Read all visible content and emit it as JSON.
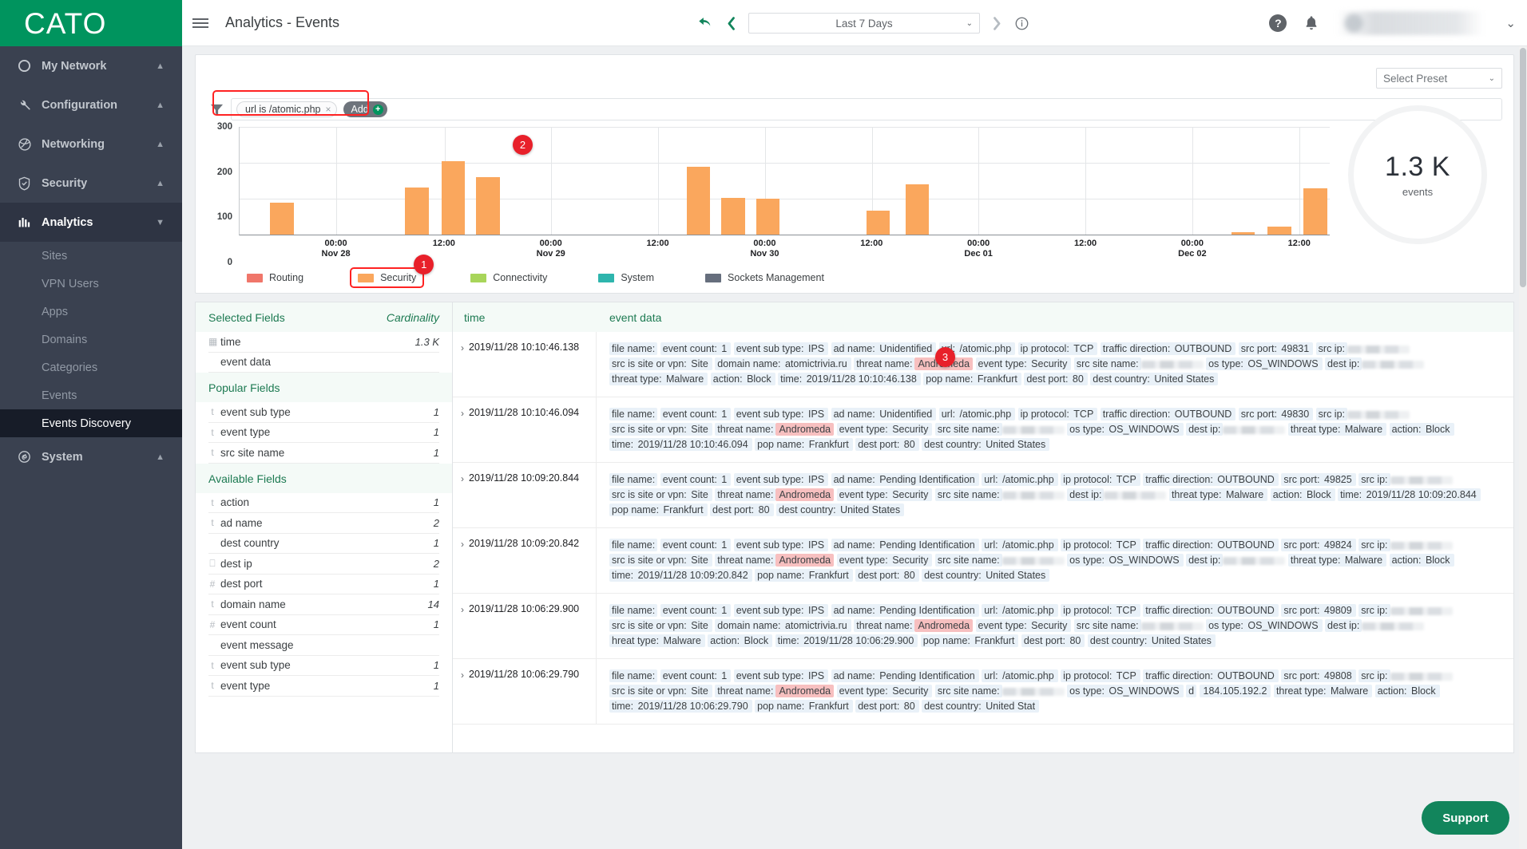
{
  "brand": {
    "name": "CATO"
  },
  "sidebar": {
    "groups": [
      {
        "label": "My Network",
        "icon": "circle-icon",
        "chevron": "▲"
      },
      {
        "label": "Configuration",
        "icon": "wrench-icon",
        "chevron": "▲"
      },
      {
        "label": "Networking",
        "icon": "network-icon",
        "chevron": "▲"
      },
      {
        "label": "Security",
        "icon": "shield-check-icon",
        "chevron": "▲"
      },
      {
        "label": "Analytics",
        "icon": "bar-chart-icon",
        "chevron": "▼"
      },
      {
        "label": "System",
        "icon": "system-icon",
        "chevron": "▲"
      }
    ],
    "analytics_items": [
      {
        "label": "Sites"
      },
      {
        "label": "VPN Users"
      },
      {
        "label": "Apps"
      },
      {
        "label": "Domains"
      },
      {
        "label": "Categories"
      },
      {
        "label": "Events"
      },
      {
        "label": "Events Discovery"
      }
    ],
    "selected_item": "Events Discovery"
  },
  "topbar": {
    "menu_icon": "hamburger-icon",
    "title": "Analytics - Events",
    "undo_icon": "undo-arrow-icon",
    "prev_icon": "chevron-left-icon",
    "next_icon": "chevron-right-icon",
    "info_icon": "info-circle-icon",
    "date_range": "Last 7 Days",
    "date_caret": "⌄",
    "help_icon": "?",
    "bell_icon": "bell-icon",
    "user_caret": "⌄"
  },
  "toolbar": {
    "preset_placeholder": "Select Preset",
    "preset_caret": "⌄",
    "funnel_icon": "filter-funnel-icon"
  },
  "filters": {
    "chips": [
      {
        "label": "url is /atomic.php",
        "remove": "×"
      }
    ],
    "add_label": "Add",
    "add_plus": "+"
  },
  "annotations": [
    {
      "id": "1",
      "target": "legend-security"
    },
    {
      "id": "2",
      "target": "filter-bar"
    },
    {
      "id": "3",
      "target": "threat-name-andromeda"
    }
  ],
  "chart_data": {
    "type": "bar",
    "title": "",
    "xlabel": "",
    "ylabel": "",
    "ylim": [
      0,
      300
    ],
    "yticks": [
      0,
      100,
      200,
      300
    ],
    "grid": true,
    "legend_position": "bottom",
    "xticks": [
      {
        "time": "00:00",
        "date": "Nov 28",
        "pos": 8.9
      },
      {
        "time": "12:00",
        "date": "",
        "pos": 18.8
      },
      {
        "time": "00:00",
        "date": "Nov 29",
        "pos": 28.6
      },
      {
        "time": "12:00",
        "date": "",
        "pos": 38.4
      },
      {
        "time": "00:00",
        "date": "Nov 30",
        "pos": 48.2
      },
      {
        "time": "12:00",
        "date": "",
        "pos": 58.0
      },
      {
        "time": "00:00",
        "date": "Dec 01",
        "pos": 67.8
      },
      {
        "time": "12:00",
        "date": "",
        "pos": 77.6
      },
      {
        "time": "00:00",
        "date": "Dec 02",
        "pos": 87.4
      },
      {
        "time": "12:00",
        "date": "",
        "pos": 97.2
      }
    ],
    "series": [
      {
        "name": "Routing",
        "color": "#f0766a",
        "values": []
      },
      {
        "name": "Security",
        "color": "#faa75d",
        "points": [
          {
            "x": 2.8,
            "value": 90
          },
          {
            "x": 15.2,
            "value": 132
          },
          {
            "x": 18.5,
            "value": 205
          },
          {
            "x": 21.7,
            "value": 160
          },
          {
            "x": 41.0,
            "value": 190
          },
          {
            "x": 44.2,
            "value": 102
          },
          {
            "x": 47.4,
            "value": 100
          },
          {
            "x": 57.5,
            "value": 67
          },
          {
            "x": 61.1,
            "value": 140
          },
          {
            "x": 91.0,
            "value": 6
          },
          {
            "x": 94.3,
            "value": 22
          },
          {
            "x": 97.6,
            "value": 130
          }
        ]
      },
      {
        "name": "Connectivity",
        "color": "#a8d55a",
        "values": []
      },
      {
        "name": "System",
        "color": "#2eb5ad",
        "values": []
      },
      {
        "name": "Sockets Management",
        "color": "#666e7d",
        "values": []
      }
    ],
    "total": {
      "value": "1.3 K",
      "label": "events"
    }
  },
  "fields_panel": {
    "sections": [
      {
        "title": "Selected Fields",
        "right_title": "Cardinality",
        "rows": [
          {
            "type": "calendar-icon",
            "name": "time",
            "cardinality": "1.3 K"
          },
          {
            "type": "",
            "name": "event data",
            "cardinality": ""
          }
        ]
      },
      {
        "title": "Popular Fields",
        "right_title": "",
        "rows": [
          {
            "type": "t",
            "name": "event sub type",
            "cardinality": "1"
          },
          {
            "type": "t",
            "name": "event type",
            "cardinality": "1"
          },
          {
            "type": "t",
            "name": "src site name",
            "cardinality": "1"
          }
        ]
      },
      {
        "title": "Available Fields",
        "right_title": "",
        "rows": [
          {
            "type": "t",
            "name": "action",
            "cardinality": "1"
          },
          {
            "type": "t",
            "name": "ad name",
            "cardinality": "2"
          },
          {
            "type": "",
            "name": "dest country",
            "cardinality": "1"
          },
          {
            "type": "ip",
            "name": "dest ip",
            "cardinality": "2"
          },
          {
            "type": "#",
            "name": "dest port",
            "cardinality": "1"
          },
          {
            "type": "t",
            "name": "domain name",
            "cardinality": "14"
          },
          {
            "type": "#",
            "name": "event count",
            "cardinality": "1"
          },
          {
            "type": "",
            "name": "event message",
            "cardinality": ""
          },
          {
            "type": "t",
            "name": "event sub type",
            "cardinality": "1"
          },
          {
            "type": "t",
            "name": "event type",
            "cardinality": "1"
          }
        ]
      }
    ]
  },
  "events_table": {
    "columns": {
      "time": "time",
      "data": "event data"
    },
    "rows": [
      {
        "time": "2019/11/28 10:10:46.138",
        "tokens": [
          {
            "k": "file name:",
            "v": ""
          },
          {
            "k": "event count:",
            "v": "1"
          },
          {
            "k": "event sub type:",
            "v": "IPS"
          },
          {
            "k": "ad name:",
            "v": "Unidentified"
          },
          {
            "k": "url:",
            "v": "/atomic.php"
          },
          {
            "k": "ip protocol:",
            "v": "TCP"
          },
          {
            "k": "traffic direction:",
            "v": "OUTBOUND"
          },
          {
            "k": "src port:",
            "v": "49831"
          },
          {
            "k": "src ip:",
            "v": "REDACTED"
          },
          {
            "k": "src is site or vpn:",
            "v": "Site"
          },
          {
            "k": "domain name:",
            "v": "atomictrivia.ru"
          },
          {
            "k": "threat name:",
            "v": "Andromeda",
            "highlight": true
          },
          {
            "k": "event type:",
            "v": "Security"
          },
          {
            "k": "src site name:",
            "v": "REDACTED"
          },
          {
            "k": "os type:",
            "v": "OS_WINDOWS"
          },
          {
            "k": "dest ip:",
            "v": "REDACTED"
          },
          {
            "k": "threat type:",
            "v": "Malware"
          },
          {
            "k": "action:",
            "v": "Block"
          },
          {
            "k": "time:",
            "v": "2019/11/28 10:10:46.138"
          },
          {
            "k": "pop name:",
            "v": "Frankfurt"
          },
          {
            "k": "dest port:",
            "v": "80"
          },
          {
            "k": "dest country:",
            "v": "United States"
          }
        ]
      },
      {
        "time": "2019/11/28 10:10:46.094",
        "tokens": [
          {
            "k": "file name:",
            "v": ""
          },
          {
            "k": "event count:",
            "v": "1"
          },
          {
            "k": "event sub type:",
            "v": "IPS"
          },
          {
            "k": "ad name:",
            "v": "Unidentified"
          },
          {
            "k": "url:",
            "v": "/atomic.php"
          },
          {
            "k": "ip protocol:",
            "v": "TCP"
          },
          {
            "k": "traffic direction:",
            "v": "OUTBOUND"
          },
          {
            "k": "src port:",
            "v": "49830"
          },
          {
            "k": "src ip:",
            "v": "REDACTED"
          },
          {
            "k": "src is site or vpn:",
            "v": "Site"
          },
          {
            "k": "threat name:",
            "v": "Andromeda",
            "highlight": true
          },
          {
            "k": "event type:",
            "v": "Security"
          },
          {
            "k": "src site name:",
            "v": "REDACTED"
          },
          {
            "k": "os type:",
            "v": "OS_WINDOWS"
          },
          {
            "k": "dest ip:",
            "v": "REDACTED"
          },
          {
            "k": "threat type:",
            "v": "Malware"
          },
          {
            "k": "action:",
            "v": "Block"
          },
          {
            "k": "time:",
            "v": "2019/11/28 10:10:46.094"
          },
          {
            "k": "pop name:",
            "v": "Frankfurt"
          },
          {
            "k": "dest port:",
            "v": "80"
          },
          {
            "k": "dest country:",
            "v": "United States"
          }
        ]
      },
      {
        "time": "2019/11/28 10:09:20.844",
        "tokens": [
          {
            "k": "file name:",
            "v": ""
          },
          {
            "k": "event count:",
            "v": "1"
          },
          {
            "k": "event sub type:",
            "v": "IPS"
          },
          {
            "k": "ad name:",
            "v": "Pending Identification"
          },
          {
            "k": "url:",
            "v": "/atomic.php"
          },
          {
            "k": "ip protocol:",
            "v": "TCP"
          },
          {
            "k": "traffic direction:",
            "v": "OUTBOUND"
          },
          {
            "k": "src port:",
            "v": "49825"
          },
          {
            "k": "src ip:",
            "v": "REDACTED"
          },
          {
            "k": "src is site or vpn:",
            "v": "Site"
          },
          {
            "k": "threat name:",
            "v": "Andromeda",
            "highlight": true
          },
          {
            "k": "event type:",
            "v": "Security"
          },
          {
            "k": "src site name:",
            "v": "REDACTED"
          },
          {
            "k": "dest ip:",
            "v": "REDACTED"
          },
          {
            "k": "threat type:",
            "v": "Malware"
          },
          {
            "k": "action:",
            "v": "Block"
          },
          {
            "k": "time:",
            "v": "2019/11/28 10:09:20.844"
          },
          {
            "k": "pop name:",
            "v": "Frankfurt"
          },
          {
            "k": "dest port:",
            "v": "80"
          },
          {
            "k": "dest country:",
            "v": "United States"
          }
        ]
      },
      {
        "time": "2019/11/28 10:09:20.842",
        "tokens": [
          {
            "k": "file name:",
            "v": ""
          },
          {
            "k": "event count:",
            "v": "1"
          },
          {
            "k": "event sub type:",
            "v": "IPS"
          },
          {
            "k": "ad name:",
            "v": "Pending Identification"
          },
          {
            "k": "url:",
            "v": "/atomic.php"
          },
          {
            "k": "ip protocol:",
            "v": "TCP"
          },
          {
            "k": "traffic direction:",
            "v": "OUTBOUND"
          },
          {
            "k": "src port:",
            "v": "49824"
          },
          {
            "k": "src ip:",
            "v": "REDACTED"
          },
          {
            "k": "src is site or vpn:",
            "v": "Site"
          },
          {
            "k": "threat name:",
            "v": "Andromeda",
            "highlight": true
          },
          {
            "k": "event type:",
            "v": "Security"
          },
          {
            "k": "src site name:",
            "v": "REDACTED"
          },
          {
            "k": "os type:",
            "v": "OS_WINDOWS"
          },
          {
            "k": "dest ip:",
            "v": "REDACTED"
          },
          {
            "k": "threat type:",
            "v": "Malware"
          },
          {
            "k": "action:",
            "v": "Block"
          },
          {
            "k": "time:",
            "v": "2019/11/28 10:09:20.842"
          },
          {
            "k": "pop name:",
            "v": "Frankfurt"
          },
          {
            "k": "dest port:",
            "v": "80"
          },
          {
            "k": "dest country:",
            "v": "United States"
          }
        ]
      },
      {
        "time": "2019/11/28 10:06:29.900",
        "tokens": [
          {
            "k": "file name:",
            "v": ""
          },
          {
            "k": "event count:",
            "v": "1"
          },
          {
            "k": "event sub type:",
            "v": "IPS"
          },
          {
            "k": "ad name:",
            "v": "Pending Identification"
          },
          {
            "k": "url:",
            "v": "/atomic.php"
          },
          {
            "k": "ip protocol:",
            "v": "TCP"
          },
          {
            "k": "traffic direction:",
            "v": "OUTBOUND"
          },
          {
            "k": "src port:",
            "v": "49809"
          },
          {
            "k": "src ip:",
            "v": "REDACTED"
          },
          {
            "k": "src is site or vpn:",
            "v": "Site"
          },
          {
            "k": "domain name:",
            "v": "atomictrivia.ru"
          },
          {
            "k": "threat name:",
            "v": "Andromeda",
            "highlight": true
          },
          {
            "k": "event type:",
            "v": "Security"
          },
          {
            "k": "src site name:",
            "v": "REDACTED"
          },
          {
            "k": "os type:",
            "v": "OS_WINDOWS"
          },
          {
            "k": "dest ip:",
            "v": "REDACTED"
          },
          {
            "k": "hreat type:",
            "v": "Malware"
          },
          {
            "k": "action:",
            "v": "Block"
          },
          {
            "k": "time:",
            "v": "2019/11/28 10:06:29.900"
          },
          {
            "k": "pop name:",
            "v": "Frankfurt"
          },
          {
            "k": "dest port:",
            "v": "80"
          },
          {
            "k": "dest country:",
            "v": "United States"
          }
        ]
      },
      {
        "time": "2019/11/28 10:06:29.790",
        "tokens": [
          {
            "k": "file name:",
            "v": ""
          },
          {
            "k": "event count:",
            "v": "1"
          },
          {
            "k": "event sub type:",
            "v": "IPS"
          },
          {
            "k": "ad name:",
            "v": "Pending Identification"
          },
          {
            "k": "url:",
            "v": "/atomic.php"
          },
          {
            "k": "ip protocol:",
            "v": "TCP"
          },
          {
            "k": "traffic direction:",
            "v": "OUTBOUND"
          },
          {
            "k": "src port:",
            "v": "49808"
          },
          {
            "k": "src ip:",
            "v": "REDACTED"
          },
          {
            "k": "src is site or vpn:",
            "v": "Site"
          },
          {
            "k": "threat name:",
            "v": "Andromeda",
            "highlight": true
          },
          {
            "k": "event type:",
            "v": "Security"
          },
          {
            "k": "src site name:",
            "v": "REDACTED"
          },
          {
            "k": "os type:",
            "v": "OS_WINDOWS"
          },
          {
            "k": "d",
            "v": ""
          },
          {
            "k": "",
            "v": "184.105.192.2"
          },
          {
            "k": "threat type:",
            "v": "Malware"
          },
          {
            "k": "action:",
            "v": "Block"
          },
          {
            "k": "time:",
            "v": "2019/11/28 10:06:29.790"
          },
          {
            "k": "pop name:",
            "v": "Frankfurt"
          },
          {
            "k": "dest port:",
            "v": "80"
          },
          {
            "k": "dest country:",
            "v": "United Stat"
          }
        ]
      }
    ]
  },
  "support": {
    "label": "Support"
  }
}
